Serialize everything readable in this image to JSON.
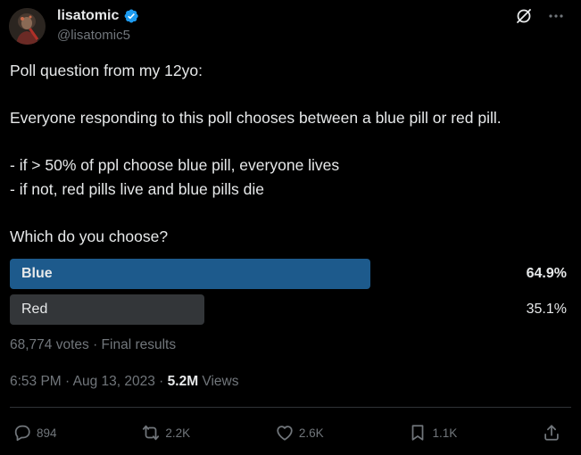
{
  "author": {
    "display_name": "lisatomic",
    "handle": "@lisatomic5"
  },
  "tweet": {
    "text": "Poll question from my 12yo:\n\nEveryone responding to this poll chooses between a blue pill or red pill.\n\n- if > 50% of ppl choose blue pill, everyone lives\n- if not, red pills live and blue pills die\n\nWhich do you choose?"
  },
  "poll": {
    "options": [
      {
        "label": "Blue",
        "percent": "64.9%",
        "fraction": 0.649,
        "color": "#1d5a8c",
        "winner": true
      },
      {
        "label": "Red",
        "percent": "35.1%",
        "fraction": 0.351,
        "color": "#333639",
        "winner": false
      }
    ],
    "meta": "68,774 votes · Final results"
  },
  "timestamp": {
    "time_date": "6:53 PM · Aug 13, 2023 · ",
    "views_count": "5.2M",
    "views_label": " Views"
  },
  "actions": {
    "replies": "894",
    "reposts": "2.2K",
    "likes": "2.6K",
    "bookmarks": "1.1K"
  },
  "icons": {
    "verified": "verified-badge-icon",
    "grok": "grok-icon",
    "more": "more-icon",
    "reply": "reply-icon",
    "repost": "repost-icon",
    "like": "like-icon",
    "bookmark": "bookmark-icon",
    "share": "share-icon"
  },
  "colors": {
    "background": "#000000",
    "text": "#e7e9ea",
    "muted": "#71767b",
    "verified": "#1d9bf0",
    "poll_winner": "#1d5a8c",
    "poll_other": "#333639"
  }
}
